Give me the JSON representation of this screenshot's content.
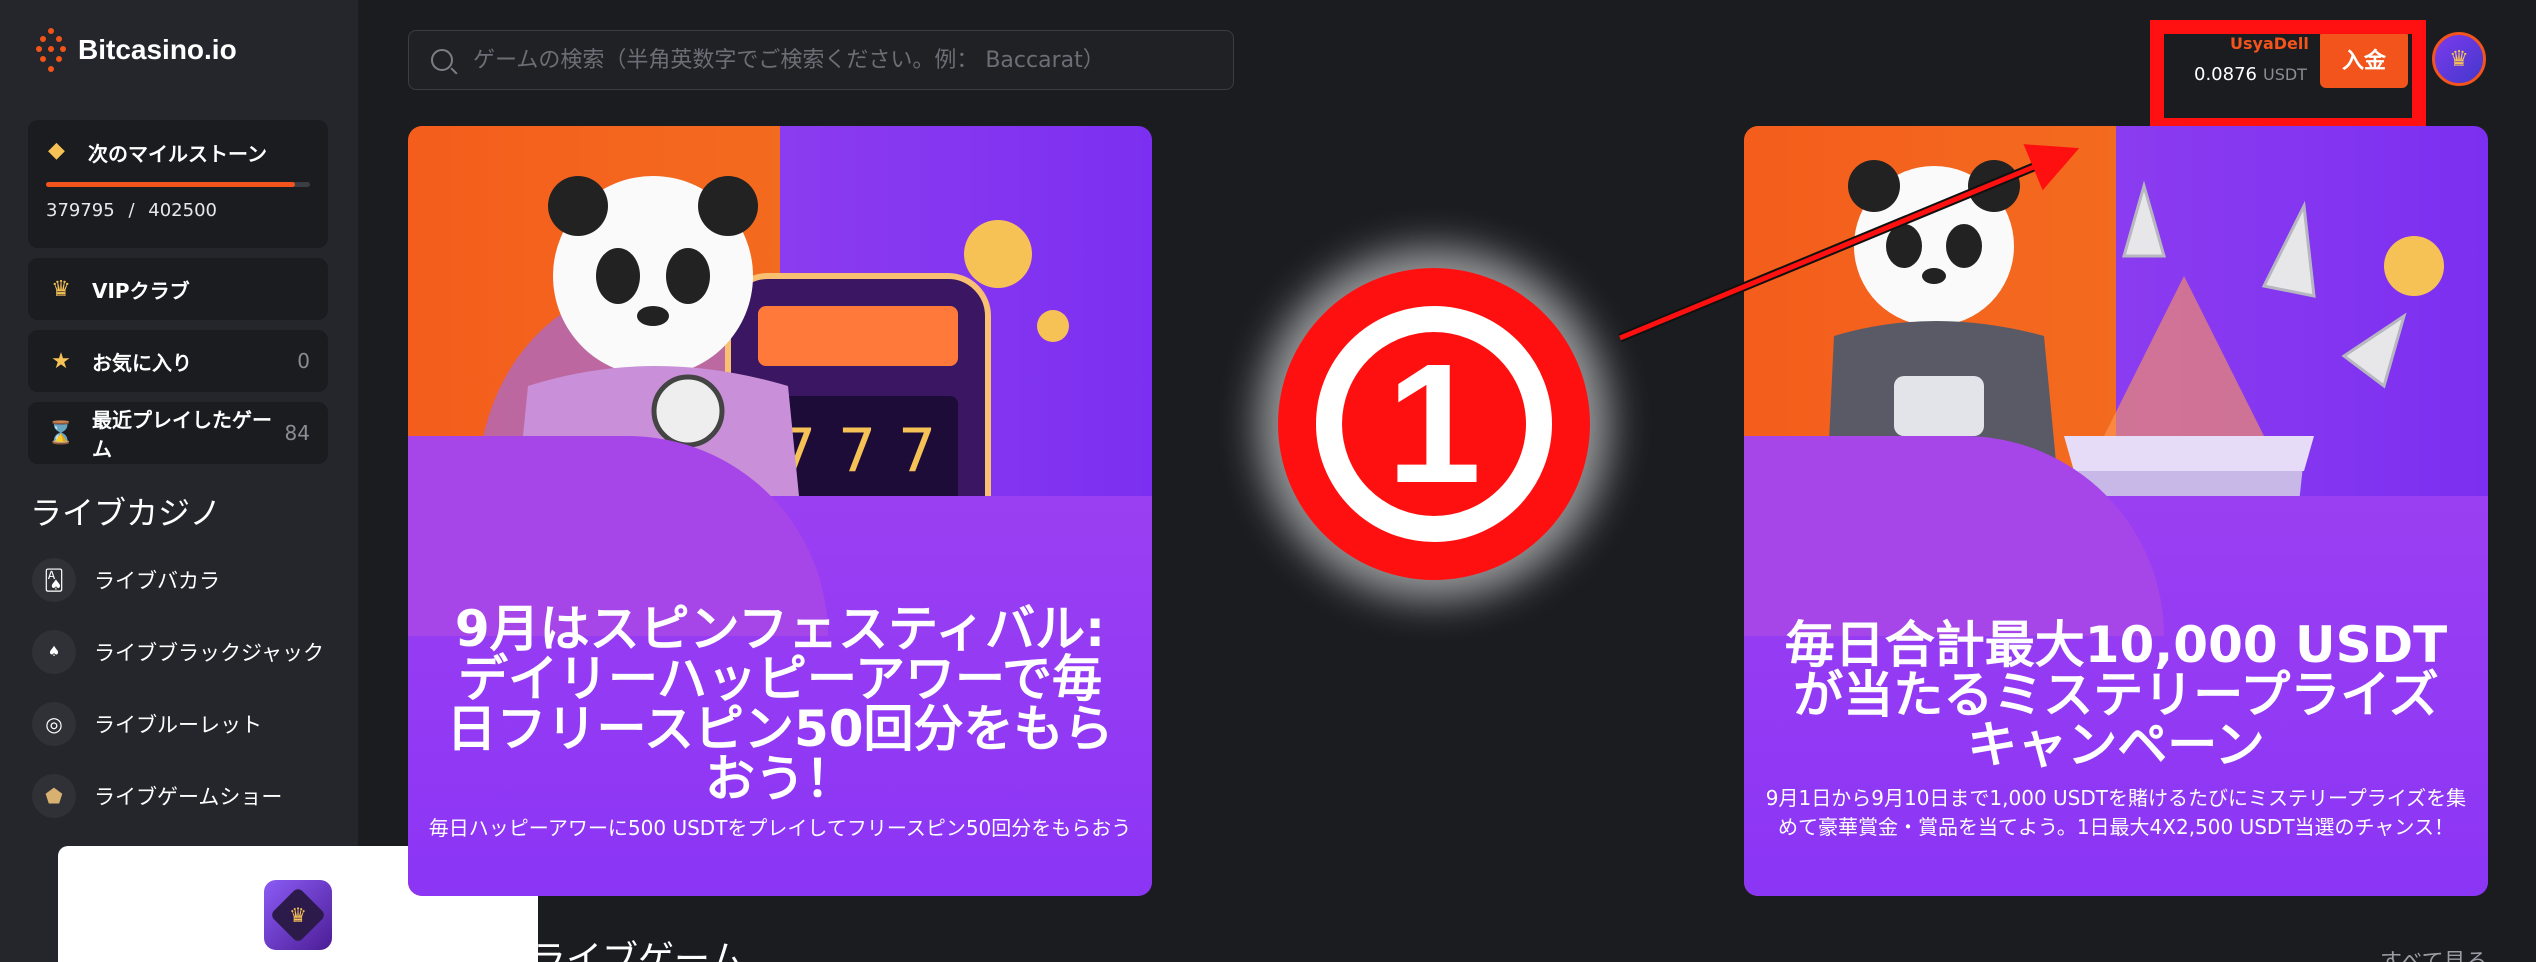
{
  "app": {
    "logo_text": "Bitcasino.io"
  },
  "search": {
    "placeholder": "ゲームの検索（半角英数字でご検索ください。例： Baccarat）"
  },
  "sidebar": {
    "milestone": {
      "title": "次のマイルストーン",
      "current": "379795",
      "separator": "/",
      "target": "402500",
      "progress": 0.943,
      "icon": "diamond-icon"
    },
    "items": [
      {
        "label": "VIPクラブ",
        "count": "",
        "icon": "crown-icon"
      },
      {
        "label": "お気に入り",
        "count": "0",
        "icon": "star-icon"
      },
      {
        "label": "最近プレイしたゲーム",
        "count": "84",
        "icon": "hourglass-icon"
      }
    ],
    "section_title": "ライブカジノ",
    "live_items": [
      {
        "label": "ライブバカラ",
        "icon": "cards-icon"
      },
      {
        "label": "ライブブラックジャック",
        "icon": "blackjack-icon"
      },
      {
        "label": "ライブルーレット",
        "icon": "roulette-icon"
      },
      {
        "label": "ライブゲームショー",
        "icon": "gameshow-icon"
      }
    ]
  },
  "header": {
    "username": "UsyaDell",
    "balance": "0.0876",
    "currency": "USDT",
    "deposit_label": "入金"
  },
  "banners": [
    {
      "title": "9月はスピンフェスティバル: デイリーハッピーアワーで毎日フリースピン50回分をもらおう！",
      "subtitle": "毎日ハッピーアワーに500 USDTをプレイしてフリースピン50回分をもらおう"
    },
    {
      "title": "毎日合計最大10,000 USDTが当たるミステリープライズキャンペーン",
      "subtitle": "9月1日から9月10日まで1,000 USDTを賭けるたびにミステリープライズを集めて豪華賞金・賞品を当てよう。1日最大4X2,500 USDT当選のチャンス！"
    }
  ],
  "annotation": {
    "number": "1"
  },
  "below": {
    "section_title": "ライブゲーム",
    "right_link": "すべて見る"
  },
  "popup": {
    "close_label": "×"
  },
  "colors": {
    "accent": "#f2541b",
    "annotation_red": "#ff1010",
    "bg": "#1a1c20",
    "sidebar": "#24262b"
  }
}
